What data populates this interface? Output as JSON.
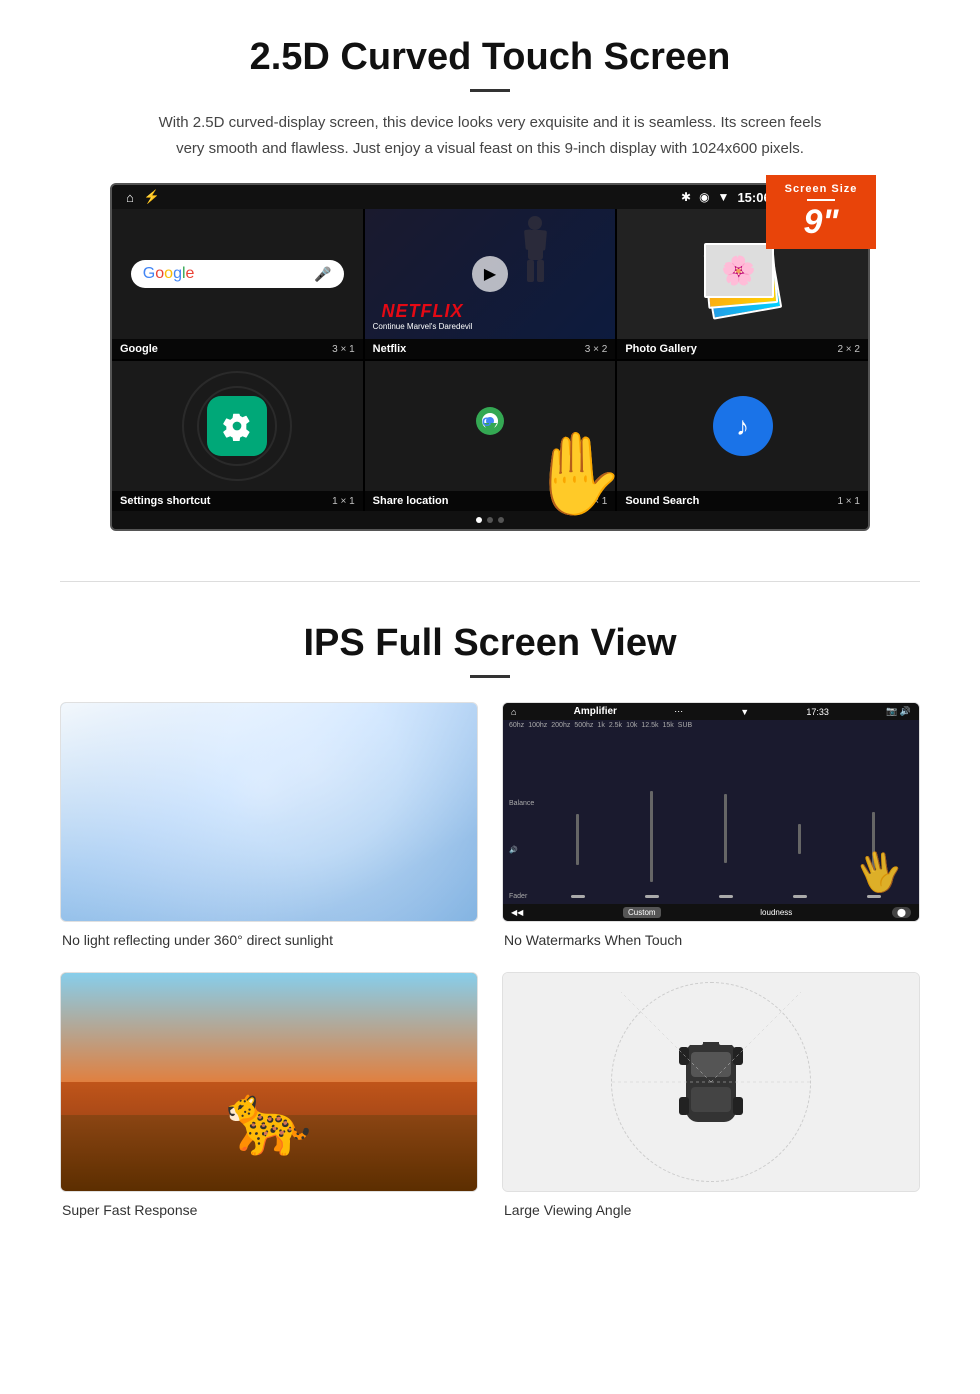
{
  "section1": {
    "title": "2.5D Curved Touch Screen",
    "description": "With 2.5D curved-display screen, this device looks very exquisite and it is seamless. Its screen feels very smooth and flawless. Just enjoy a visual feast on this 9-inch display with 1024x600 pixels.",
    "badge": {
      "top_label": "Screen Size",
      "size": "9\""
    },
    "status_bar": {
      "time": "15:06"
    },
    "apps": [
      {
        "name": "Google",
        "size": "3 × 1"
      },
      {
        "name": "Netflix",
        "size": "3 × 2"
      },
      {
        "name": "Photo Gallery",
        "size": "2 × 2"
      },
      {
        "name": "Settings shortcut",
        "size": "1 × 1"
      },
      {
        "name": "Share location",
        "size": "1 × 1"
      },
      {
        "name": "Sound Search",
        "size": "1 × 1"
      }
    ],
    "netflix_text": {
      "logo": "NETFLIX",
      "subtitle": "Continue Marvel's Daredevil"
    }
  },
  "section2": {
    "title": "IPS Full Screen View",
    "features": [
      {
        "id": "sunlight",
        "caption": "No light reflecting under 360° direct sunlight"
      },
      {
        "id": "watermark",
        "caption": "No Watermarks When Touch"
      },
      {
        "id": "cheetah",
        "caption": "Super Fast Response"
      },
      {
        "id": "car",
        "caption": "Large Viewing Angle"
      }
    ],
    "amplifier": {
      "title": "Amplifier",
      "time": "17:33",
      "footer_label": "Custom",
      "footer_right": "loudness"
    }
  }
}
